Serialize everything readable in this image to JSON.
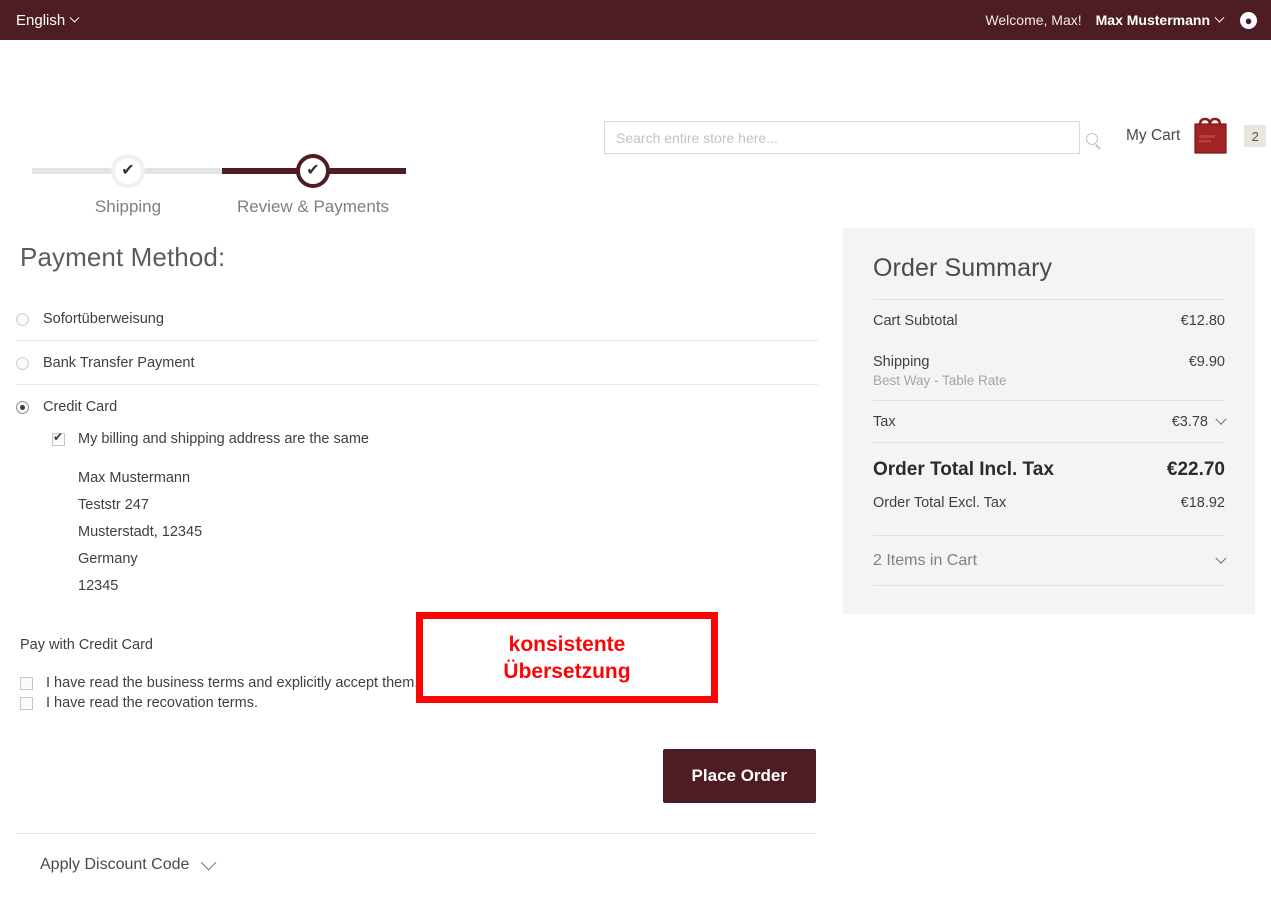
{
  "topbar": {
    "language": "English",
    "welcome": "Welcome, Max!",
    "account_name": "Max Mustermann",
    "avatar_icon": "user-circle-icon",
    "chevron_icon": "chevron-down-icon"
  },
  "header": {
    "search_placeholder": "Search entire store here...",
    "search_value": "",
    "search_icon": "search-icon",
    "cart_label": "My Cart",
    "cart_icon": "shopping-bag-icon",
    "cart_count": "2"
  },
  "progress": {
    "steps": [
      {
        "label": "Shipping",
        "state": "done",
        "icon": "check-icon"
      },
      {
        "label": "Review & Payments",
        "state": "active",
        "icon": "check-icon"
      }
    ]
  },
  "payment": {
    "heading": "Payment Method:",
    "methods": [
      {
        "label": "Sofortüberweisung",
        "selected": false
      },
      {
        "label": "Bank Transfer Payment",
        "selected": false
      },
      {
        "label": "Credit Card",
        "selected": true
      }
    ],
    "billing_same_label": "My billing and shipping address are the same",
    "billing_same_checked": true,
    "address": [
      "Max Mustermann",
      "Teststr 247",
      "Musterstadt, 12345",
      "Germany",
      "12345"
    ],
    "pay_with_label": "Pay with Credit Card",
    "terms": [
      {
        "label": "I have read the business terms and explicitly accept them.",
        "checked": false
      },
      {
        "label": "I have read the recovation terms.",
        "checked": false
      }
    ],
    "place_order_label": "Place Order",
    "discount_label": "Apply Discount Code",
    "discount_chevron_icon": "chevron-down-icon"
  },
  "summary": {
    "title": "Order Summary",
    "rows": [
      {
        "label": "Cart Subtotal",
        "sub": "",
        "value": "€12.80"
      },
      {
        "label": "Shipping",
        "sub": "Best Way - Table Rate",
        "value": "€9.90"
      },
      {
        "label": "Tax",
        "sub": "",
        "value": "€3.78"
      }
    ],
    "tax_chevron_icon": "chevron-down-icon",
    "grand_label": "Order Total Incl. Tax",
    "grand_value": "€22.70",
    "excl_label": "Order Total Excl. Tax",
    "excl_value": "€18.92",
    "items_label": "2 Items in Cart",
    "items_chevron_icon": "chevron-down-icon"
  },
  "annotation": {
    "line1": "konsistente",
    "line2": "Übersetzung",
    "color": "#fb0606"
  }
}
